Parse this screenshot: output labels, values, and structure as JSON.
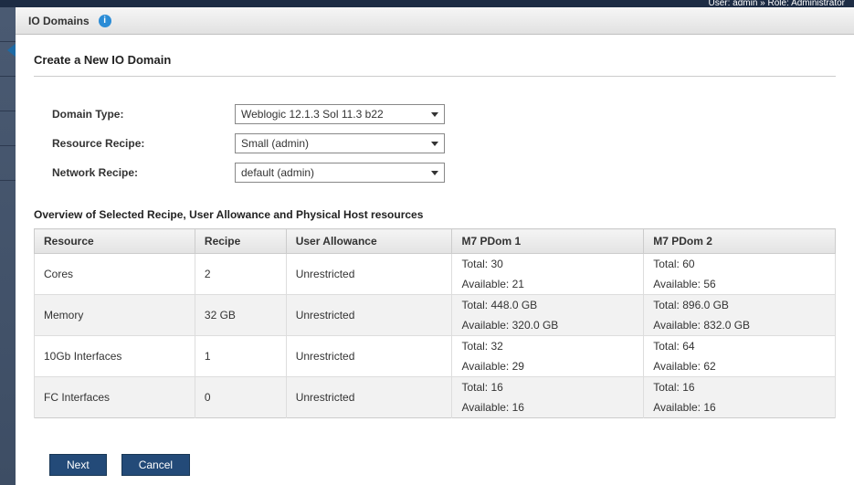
{
  "topbar_user": "User: admin » Role: Administrator",
  "header": {
    "title": "IO Domains"
  },
  "page": {
    "title": "Create a New IO Domain"
  },
  "form": {
    "domain_type": {
      "label": "Domain Type:",
      "value": "Weblogic 12.1.3 Sol 11.3 b22"
    },
    "resource_recipe": {
      "label": "Resource Recipe:",
      "value": "Small (admin)"
    },
    "network_recipe": {
      "label": "Network Recipe:",
      "value": "default (admin)"
    }
  },
  "overview": {
    "title": "Overview of Selected Recipe, User Allowance and Physical Host resources",
    "headers": [
      "Resource",
      "Recipe",
      "User Allowance",
      "M7 PDom 1",
      "M7 PDom 2"
    ],
    "rows": [
      {
        "resource": "Cores",
        "recipe": "2",
        "allowance": "Unrestricted",
        "p1_total": "Total: 30",
        "p1_avail": "Available: 21",
        "p2_total": "Total: 60",
        "p2_avail": "Available: 56",
        "striped": false
      },
      {
        "resource": "Memory",
        "recipe": "32 GB",
        "allowance": "Unrestricted",
        "p1_total": "Total: 448.0 GB",
        "p1_avail": "Available: 320.0 GB",
        "p2_total": "Total: 896.0 GB",
        "p2_avail": "Available: 832.0 GB",
        "striped": true
      },
      {
        "resource": "10Gb Interfaces",
        "recipe": "1",
        "allowance": "Unrestricted",
        "p1_total": "Total: 32",
        "p1_avail": "Available: 29",
        "p2_total": "Total: 64",
        "p2_avail": "Available: 62",
        "striped": false
      },
      {
        "resource": "FC Interfaces",
        "recipe": "0",
        "allowance": "Unrestricted",
        "p1_total": "Total: 16",
        "p1_avail": "Available: 16",
        "p2_total": "Total: 16",
        "p2_avail": "Available: 16",
        "striped": true
      }
    ]
  },
  "buttons": {
    "next": "Next",
    "cancel": "Cancel"
  }
}
